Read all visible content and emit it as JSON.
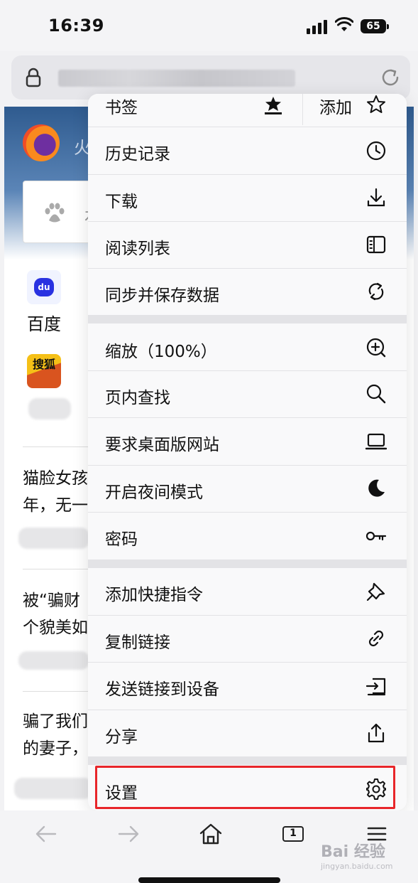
{
  "status": {
    "time": "16:39",
    "battery": "65"
  },
  "url_bar": {
    "icons": [
      "lock-icon",
      "reload-icon"
    ]
  },
  "page": {
    "hero_text": "火",
    "search_char": "右",
    "sites": [
      {
        "label": "百度",
        "icon": "baidu-icon"
      },
      {
        "label": "",
        "icon": "sohu-icon",
        "icon_text": "搜狐"
      }
    ],
    "news": [
      {
        "line1": "猫脸女孩",
        "line2": "年，无一"
      },
      {
        "line1": "被“骗财",
        "line2": "个貌美如"
      },
      {
        "line1": "骗了我们",
        "line2": "的妻子，"
      }
    ]
  },
  "menu": {
    "bookmark": {
      "label": "书签",
      "add_label": "添加",
      "icons": [
        "bookmark-star-icon",
        "star-icon"
      ]
    },
    "items": [
      {
        "label": "历史记录",
        "icon": "clock-icon"
      },
      {
        "label": "下载",
        "icon": "download-icon"
      },
      {
        "label": "阅读列表",
        "icon": "reading-list-icon"
      },
      {
        "label": "同步并保存数据",
        "icon": "sync-icon"
      },
      {
        "label": "缩放（100%）",
        "icon": "zoom-in-icon"
      },
      {
        "label": "页内查找",
        "icon": "search-icon"
      },
      {
        "label": "要求桌面版网站",
        "icon": "laptop-icon"
      },
      {
        "label": "开启夜间模式",
        "icon": "moon-icon"
      },
      {
        "label": "密码",
        "icon": "key-icon"
      },
      {
        "label": "添加快捷指令",
        "icon": "pin-icon"
      },
      {
        "label": "复制链接",
        "icon": "link-icon"
      },
      {
        "label": "发送链接到设备",
        "icon": "send-to-device-icon"
      },
      {
        "label": "分享",
        "icon": "share-icon"
      },
      {
        "label": "设置",
        "icon": "gear-icon"
      }
    ]
  },
  "toolbar": {
    "icons": [
      "back-arrow-icon",
      "forward-arrow-icon",
      "home-icon",
      "tabs-icon",
      "menu-icon"
    ],
    "tab_count": "1"
  },
  "watermark": {
    "main": "Bai 经验",
    "sub": "jingyan.baidu.com"
  },
  "colors": {
    "highlight": "#e8262a",
    "menu_bg": "#f9f9fa",
    "group_gap": "#e3e3e6"
  }
}
